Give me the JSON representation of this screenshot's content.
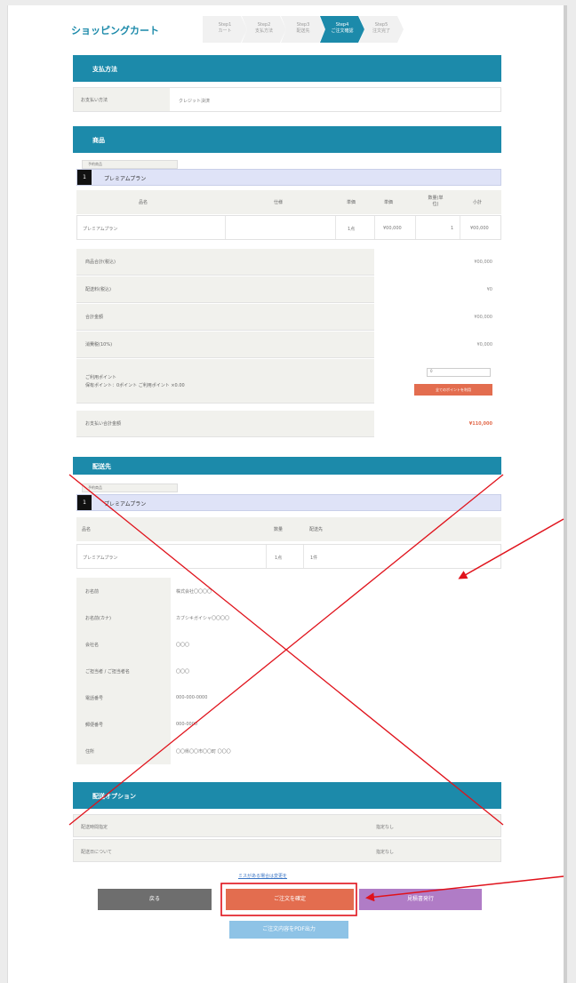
{
  "page_title": "ショッピングカート",
  "steps": [
    {
      "label1": "Step1",
      "label2": "カート",
      "active": false
    },
    {
      "label1": "Step2",
      "label2": "支払方法",
      "active": false
    },
    {
      "label1": "Step3",
      "label2": "配送先",
      "active": false
    },
    {
      "label1": "Step4",
      "label2": "ご注文確認",
      "active": true
    },
    {
      "label1": "Step5",
      "label2": "注文完了",
      "active": false
    }
  ],
  "payment": {
    "section_title": "支払方法",
    "label": "お支払い方法",
    "value": "クレジット決済"
  },
  "product": {
    "section_title": "商品",
    "tab_note": "予約商品",
    "plan_number": "1",
    "plan_name": "プレミアムプラン",
    "columns": [
      "品名",
      "仕様",
      "単価",
      "単価",
      "数量(単位)",
      "小計"
    ],
    "row": {
      "name": "プレミアムプラン",
      "spec": "",
      "price": "1点",
      "unit": "¥00,000",
      "qty": "1",
      "subtotal": "¥00,000"
    }
  },
  "summary": [
    {
      "label": "商品合計(税込)",
      "value": "¥00,000"
    },
    {
      "label": "配送料(税込)",
      "value": "¥0"
    },
    {
      "label": "合計金額",
      "value": "¥00,000"
    },
    {
      "label": "消費税(10%)",
      "value": "¥0,000"
    }
  ],
  "points": {
    "label": "ご利用ポイント",
    "note": "保有ポイント：0ポイント ご利用ポイント ×0.00",
    "input_value": "0",
    "button": "全てのポイントを利用"
  },
  "total": {
    "label": "お支払い合計金額",
    "value": "¥110,000"
  },
  "shipping": {
    "section_title": "配送先",
    "tab_note": "予約商品",
    "plan_number": "1",
    "plan_name": "プレミアムプラン",
    "columns": [
      "品名",
      "数量",
      "配送先"
    ],
    "row": {
      "name": "プレミアムプラン",
      "qty": "1点",
      "dest": "1件"
    },
    "details": [
      {
        "label": "お名前",
        "value": "株式会社〇〇〇〇"
      },
      {
        "label": "お名前(カナ)",
        "value": "カブシキガイシャ〇〇〇〇"
      },
      {
        "label": "会社名",
        "value": "〇〇〇"
      },
      {
        "label": "ご担当者 / ご担当者名",
        "value": "〇〇〇"
      },
      {
        "label": "電話番号",
        "value": "000-000-0000"
      },
      {
        "label": "郵便番号",
        "value": "000-0000"
      },
      {
        "label": "住所",
        "value": "〇〇県〇〇市〇〇町 〇〇〇"
      }
    ]
  },
  "options": {
    "section_title": "配送オプション",
    "rows": [
      {
        "label": "配送時間指定",
        "value": "指定なし"
      },
      {
        "label": "配送日について",
        "value": "指定なし"
      }
    ]
  },
  "footer": {
    "link": "ミスがある場合は変更を",
    "back_button": "戻る",
    "confirm_button": "ご注文を確定",
    "estimate_button": "見積書発行",
    "print_button": "ご注文内容をPDF出力"
  },
  "colors": {
    "accent": "#1c8aaa",
    "confirm": "#e36d4f",
    "estimate": "#b07cc6",
    "back": "#6e6e6e",
    "print": "#8ec3e6",
    "annotation": "#e0121b"
  }
}
